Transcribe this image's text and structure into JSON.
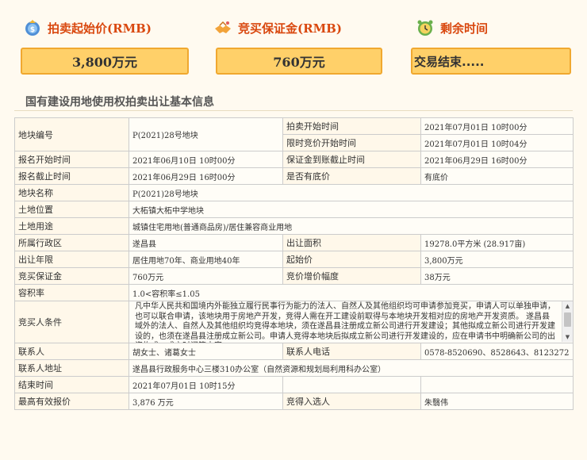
{
  "header": {
    "start_price": {
      "label": "拍卖起始价(RMB)",
      "value": "3,800万元"
    },
    "deposit": {
      "label": "竞买保证金(RMB)",
      "value": "760万元"
    },
    "remaining": {
      "label": "剩余时间",
      "value": "交易结束....."
    }
  },
  "section_title": "国有建设用地使用权拍卖出让基本信息",
  "rows": {
    "parcel_no": {
      "label": "地块编号",
      "value": "P(2021)28号地块"
    },
    "auction_start": {
      "label": "拍卖开始时间",
      "value": "2021年07月01日 10时00分"
    },
    "limit_start": {
      "label": "限时竞价开始时间",
      "value": "2021年07月01日 10时04分"
    },
    "reg_start": {
      "label": "报名开始时间",
      "value": "2021年06月10日 10时00分"
    },
    "deposit_deadline": {
      "label": "保证金到账截止时间",
      "value": "2021年06月29日 16时00分"
    },
    "reg_end": {
      "label": "报名截止时间",
      "value": "2021年06月29日 16时00分"
    },
    "reserve": {
      "label": "是否有底价",
      "value": "有底价"
    },
    "parcel_name": {
      "label": "地块名称",
      "value": "P(2021)28号地块"
    },
    "location": {
      "label": "土地位置",
      "value": "大柘镇大柘中学地块"
    },
    "usage": {
      "label": "土地用途",
      "value": "城镇住宅用地(普通商品房)/居住兼容商业用地"
    },
    "district": {
      "label": "所属行政区",
      "value": "遂昌县"
    },
    "area": {
      "label": "出让面积",
      "value": "19278.0平方米 (28.917亩)"
    },
    "term": {
      "label": "出让年限",
      "value": "居住用地70年、商业用地40年"
    },
    "start_price": {
      "label": "起始价",
      "value": "3,800万元"
    },
    "deposit": {
      "label": "竞买保证金",
      "value": "760万元"
    },
    "increment": {
      "label": "竞价增价幅度",
      "value": "38万元"
    },
    "far": {
      "label": "容积率",
      "value": "1.0<容积率≤1.05"
    },
    "conditions": {
      "label": "竞买人条件",
      "value": "凡中华人民共和国境内外能独立履行民事行为能力的法人、自然人及其他组织均可申请参加竞买，申请人可以单独申请，也可以联合申请，该地块用于房地产开发，竞得人需在开工建设前取得与本地块开发相对应的房地产开发资质。 遂昌县域外的法人、自然人及其他组织均竞得本地块，须在遂昌县注册成立新公司进行开发建设；其他拟成立新公司进行开发建设的，也须在遂昌县注册成立新公司。申请人竞得本地块后拟成立新公司进行开发建设的，应在申请书中明确新公司的出资构成、成立时间等内容。"
    },
    "contact": {
      "label": "联系人",
      "value": "胡女士、诸葛女士"
    },
    "phone": {
      "label": "联系人电话",
      "value": "0578-8520690、8528643、8123272"
    },
    "address": {
      "label": "联系人地址",
      "value": "遂昌县行政服务中心三楼310办公室（自然资源和规划局利用科办公室）"
    },
    "end_time": {
      "label": "结束时间",
      "value": "2021年07月01日 10时15分"
    },
    "highest_bid": {
      "label": "最高有效报价",
      "value": "3,876 万元"
    },
    "winner": {
      "label": "竞得入选人",
      "value": "朱翳伟"
    }
  },
  "colors": {
    "accent": "#d9480f",
    "box_bg": "#ffd069",
    "box_border": "#f0a830",
    "page_bg": "#fffaf0"
  },
  "icons": [
    "money-bag-icon",
    "handshake-icon",
    "alarm-clock-icon",
    "scroll-up-icon",
    "scroll-down-icon"
  ]
}
